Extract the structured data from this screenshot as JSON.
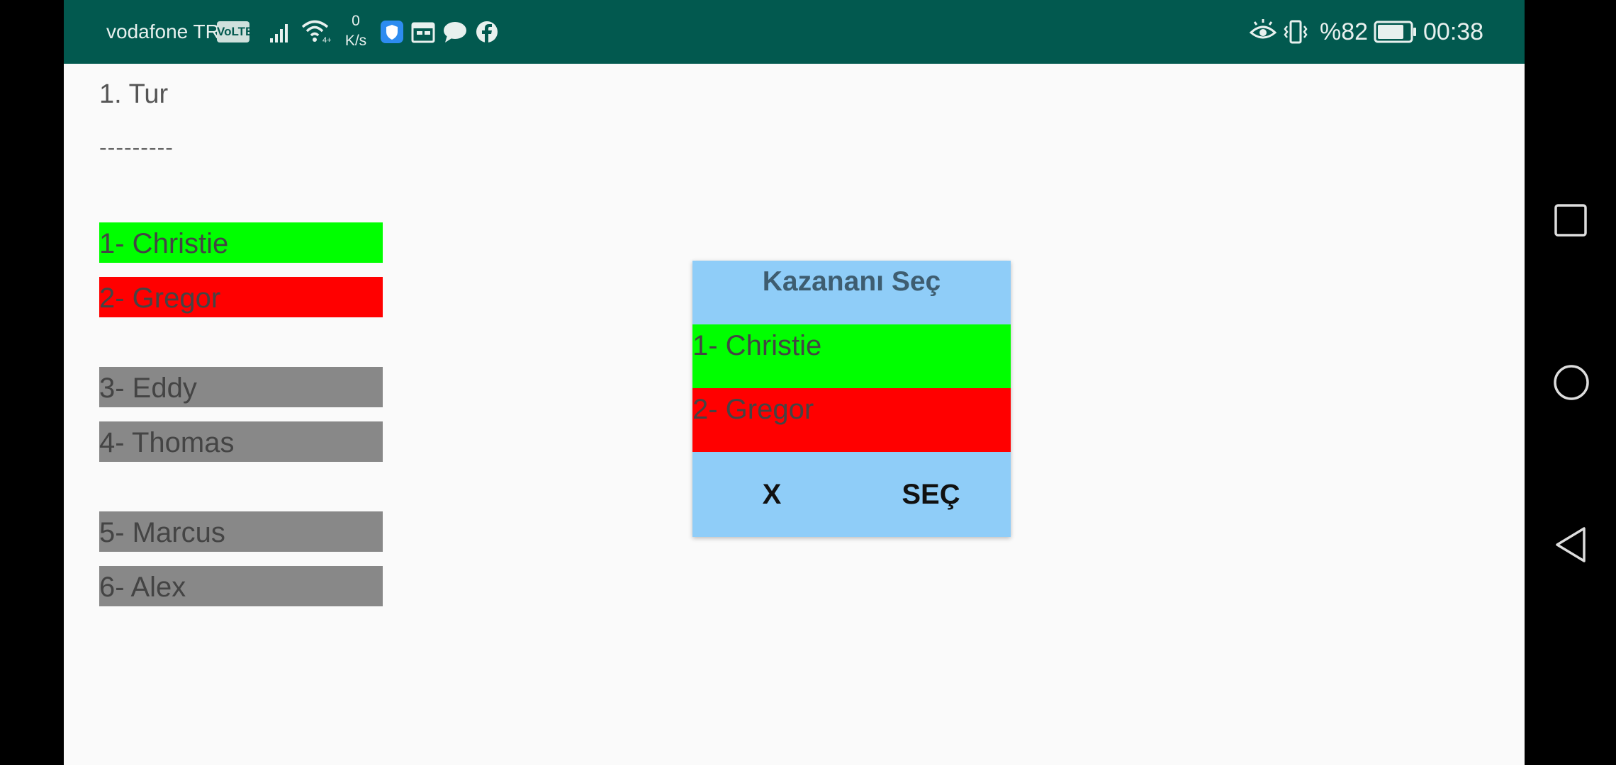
{
  "status_bar": {
    "carrier": "vodafone TR",
    "volte": "VoLTE",
    "net_speed_value": "0",
    "net_speed_unit": "K/s",
    "battery_percent": "%82",
    "time": "00:38"
  },
  "main": {
    "round_title": "1. Tur",
    "separator": "---------",
    "players": [
      {
        "label": "1- Christie",
        "color": "#00ff00"
      },
      {
        "label": "2- Gregor",
        "color": "#ff0000"
      },
      {
        "label": "3- Eddy",
        "color": "#888888"
      },
      {
        "label": "4- Thomas",
        "color": "#888888"
      },
      {
        "label": "5- Marcus",
        "color": "#888888"
      },
      {
        "label": "6- Alex",
        "color": "#888888"
      }
    ]
  },
  "dialog": {
    "title": "Kazananı Seç",
    "options": [
      {
        "label": "1- Christie",
        "color": "#00ff00"
      },
      {
        "label": "2- Gregor",
        "color": "#ff0000"
      }
    ],
    "cancel_label": "X",
    "confirm_label": "SEÇ",
    "background": "#8fcdf8"
  },
  "nav_bar": {
    "icons": [
      "recents-square-icon",
      "home-circle-icon",
      "back-triangle-icon"
    ]
  },
  "colors": {
    "status_bar": "#02594f",
    "screen_background": "#fafafa"
  }
}
